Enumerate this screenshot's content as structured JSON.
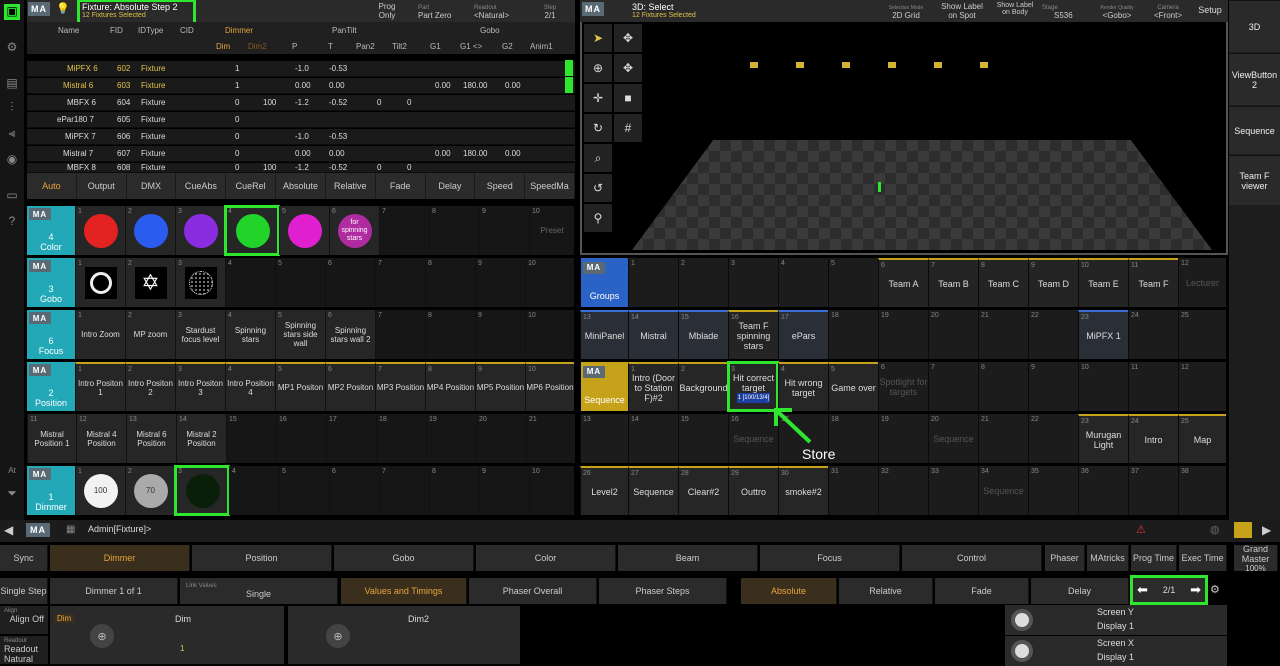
{
  "colors": {
    "accent": "#2de62d",
    "teal": "#23a8b8",
    "gold": "#c6a21a",
    "blue_group": "#2b62c6"
  },
  "sheet": {
    "ma": "MA",
    "title": "Fixture: Absolute Step 2",
    "subtitle": "12 Fixtures Selected",
    "top_items": [
      {
        "k": "Prog",
        "v": "Only"
      },
      {
        "k": "Part",
        "v": "Part Zero"
      },
      {
        "k": "Readout",
        "v": "<Natural>"
      },
      {
        "k": "Step",
        "v": "2/1"
      }
    ],
    "headers": [
      "Name",
      "FID",
      "IDType",
      "CID",
      "Dimmer",
      "PanTilt",
      "Gobo"
    ],
    "subheaders": [
      "Dim",
      "Dim2",
      "P",
      "T",
      "Pan2",
      "Tilt2",
      "G1",
      "G1 <>",
      "G2",
      "Anim1"
    ],
    "rows": [
      {
        "name": "MiPFX 6",
        "fid": "602",
        "type": "Fixture",
        "dim": "1",
        "dim2": "",
        "p": "-1.0",
        "t": "-0.53",
        "g1": "",
        "g1b": "",
        "g2": ""
      },
      {
        "name": "Mistral 6",
        "fid": "603",
        "type": "Fixture",
        "dim": "1",
        "dim2": "",
        "p": "0.00",
        "t": "0.00",
        "g1": "0.00",
        "g1b": "180.00",
        "g2": "0.00"
      },
      {
        "name": "MBFX 6",
        "fid": "604",
        "type": "Fixture",
        "dim": "0",
        "dim2": "100",
        "p": "-1.2",
        "t": "-0.52",
        "g1": "0",
        "g1b": "0",
        "g2": ""
      },
      {
        "name": "ePar180 7",
        "fid": "605",
        "type": "Fixture",
        "dim": "0",
        "dim2": "",
        "p": "",
        "t": "",
        "g1": "",
        "g1b": "",
        "g2": ""
      },
      {
        "name": "MiPFX 7",
        "fid": "606",
        "type": "Fixture",
        "dim": "0",
        "dim2": "",
        "p": "-1.0",
        "t": "-0.53",
        "g1": "",
        "g1b": "",
        "g2": ""
      },
      {
        "name": "Mistral 7",
        "fid": "607",
        "type": "Fixture",
        "dim": "0",
        "dim2": "",
        "p": "0.00",
        "t": "0.00",
        "g1": "0.00",
        "g1b": "180.00",
        "g2": "0.00"
      },
      {
        "name": "MBFX 8",
        "fid": "608",
        "type": "Fixture",
        "dim": "0",
        "dim2": "100",
        "p": "-1.2",
        "t": "-0.52",
        "g1": "0",
        "g1b": "0",
        "g2": ""
      }
    ],
    "encoder": [
      "Auto",
      "Output",
      "DMX",
      "CueAbs",
      "CueRel",
      "Absolute",
      "Relative",
      "Fade",
      "Delay",
      "Speed",
      "SpeedMa"
    ]
  },
  "pools": {
    "color": {
      "title": "4\nColor",
      "items": [
        "",
        "",
        "",
        "",
        "",
        "for spinning stars",
        "",
        "",
        "",
        "Preset"
      ],
      "colors": [
        "#e32222",
        "#2b5cf0",
        "#8a2de0",
        "#22d42a",
        "#e020d0",
        "#b02aa0"
      ]
    },
    "gobo": {
      "title": "3\nGobo"
    },
    "focus": {
      "title": "6\nFocus",
      "items": [
        "Intro Zoom",
        "MP zoom",
        "Stardust focus level",
        "Spinning stars",
        "Spinning stars side wall",
        "Spinning stars wall 2"
      ]
    },
    "position": {
      "title": "2\nPosition",
      "items": [
        "Intro Positon 1",
        "Intro Positon 2",
        "Intro Positon 3",
        "Intro Position 4",
        "MP1 Positon",
        "MP2 Positon",
        "MP3 Position",
        "MP4 Position",
        "MP5 Position",
        "MP6 Position"
      ],
      "items2": [
        "Mistral Position 1",
        "Mistral 4 Position",
        "Mistral 6 Position",
        "Mistral 2 Position"
      ]
    },
    "dimmer": {
      "title": "1\nDimmer",
      "items": [
        "100",
        "70",
        ""
      ]
    }
  },
  "viewer": {
    "title": "3D: Select",
    "subtitle": "12 Fixtures Selected",
    "top": [
      {
        "k": "Selection Mode",
        "v": "2D Grid"
      },
      {
        "k": "",
        "v": "Show Label on Spot"
      },
      {
        "k": "",
        "v": "Show Label on Body"
      },
      {
        "k": "Stage",
        "v": "S536"
      },
      {
        "k": "Render Quality",
        "v": "<Gobo>"
      },
      {
        "k": "Camera",
        "v": "<Front>"
      },
      {
        "k": "",
        "v": "Setup"
      }
    ]
  },
  "groups": {
    "title": "Groups",
    "row1": [
      "",
      "",
      "",
      "",
      "",
      "Team A",
      "Team B",
      "Team C",
      "Team D",
      "Team E",
      "Team F",
      "Lecturer"
    ],
    "row2": [
      "MiniPanel",
      "Mistral",
      "Mblade",
      "Team F spinning stars",
      "ePars",
      "",
      "",
      "",
      "",
      "",
      "MiPFX 1",
      ""
    ]
  },
  "sequence": {
    "title": "Sequence",
    "row1": [
      "Intro (Door to Station F)#2",
      "Background",
      "Hit correct target",
      "Hit wrong target",
      "Game over",
      "Spotlight for targets",
      "",
      "",
      "",
      "",
      "",
      ""
    ],
    "hit_progress": "1 [100/13/4]",
    "row2": [
      "",
      "",
      "",
      "Sequence",
      "",
      "",
      "Sequence",
      "",
      "",
      "Murugan Light",
      "Intro",
      "Map"
    ],
    "row3": [
      "Level2",
      "Sequence",
      "Clear#2",
      "Outtro",
      "smoke#2",
      "",
      "",
      "",
      "Sequence",
      "",
      "",
      ""
    ]
  },
  "annotation": {
    "label": "Store"
  },
  "right_rail": [
    "3D",
    "ViewButton 2",
    "Sequence",
    "Team F viewer"
  ],
  "command": {
    "prompt": "Admin[Fixture]>"
  },
  "features": [
    "Dimmer",
    "Position",
    "Gobo",
    "Color",
    "Beam",
    "Focus",
    "Control",
    "Phaser",
    "MAtricks",
    "Prog Time",
    "Exec Time",
    "Grand Master"
  ],
  "grand_master_value": "100%",
  "left_bottom": [
    "Sync",
    "Single Step",
    "Align Off",
    "Readout Natural"
  ],
  "feature_row2": {
    "dimmer_of": "Dimmer 1 of 1",
    "link_values_label": "Link Values",
    "link_values": "Single",
    "values_timings": "Values and Timings",
    "phaser_overall": "Phaser Overall",
    "phaser_steps": "Phaser Steps",
    "absolute": "Absolute",
    "relative": "Relative",
    "fade": "Fade",
    "delay": "Delay",
    "step": "2/1"
  },
  "encoders": {
    "dim": "Dim",
    "dim2": "Dim2",
    "dim_value": "1",
    "screen_y": "Screen Y",
    "display_y": "Display 1",
    "screen_x": "Screen X",
    "display_x": "Display 1"
  }
}
